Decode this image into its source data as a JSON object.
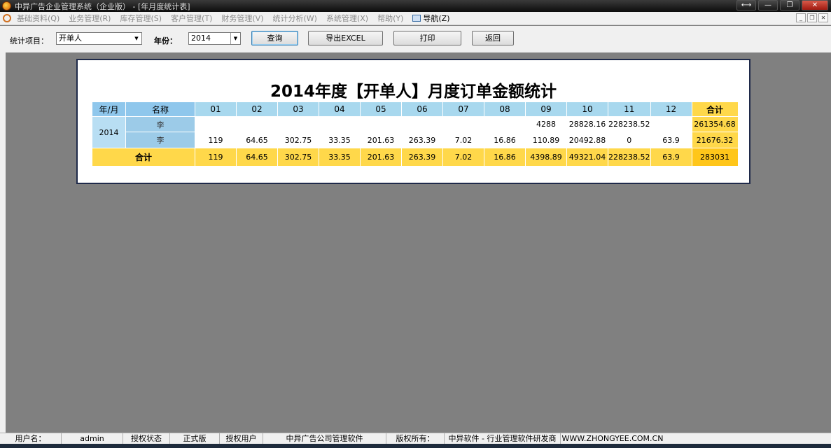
{
  "window": {
    "title": "中异广告企业管理系统（企业版） - [年月度统计表]",
    "controls": {
      "resize": "⟷",
      "minimize": "—",
      "restore": "❐",
      "close": "✕"
    }
  },
  "menu": {
    "items": [
      "基础资料(Q)",
      "业务管理(R)",
      "库存管理(S)",
      "客户管理(T)",
      "财务管理(V)",
      "统计分析(W)",
      "系统管理(X)",
      "帮助(Y)"
    ],
    "nav_label": "导航(Z)"
  },
  "toolbar": {
    "item_label": "统计项目：",
    "item_value": "开单人",
    "year_label": "年份：",
    "year_value": "2014",
    "query_btn": "查询",
    "export_btn": "导出EXCEL",
    "print_btn": "打印",
    "back_btn": "返回"
  },
  "report": {
    "title": "2014年度【开单人】月度订单金额统计",
    "headers": {
      "year_month": "年/月",
      "name": "名称",
      "months": [
        "01",
        "02",
        "03",
        "04",
        "05",
        "06",
        "07",
        "08",
        "09",
        "10",
        "11",
        "12"
      ],
      "total": "合计"
    },
    "year": "2014",
    "rows": [
      {
        "name": "李",
        "values": [
          "",
          "",
          "",
          "",
          "",
          "",
          "",
          "",
          "4288",
          "28828.16",
          "228238.52",
          ""
        ],
        "total": "261354.68"
      },
      {
        "name": "李",
        "values": [
          "119",
          "64.65",
          "302.75",
          "33.35",
          "201.63",
          "263.39",
          "7.02",
          "16.86",
          "110.89",
          "20492.88",
          "0",
          "63.9"
        ],
        "total": "21676.32"
      }
    ],
    "sum_row": {
      "label": "合计",
      "values": [
        "119",
        "64.65",
        "302.75",
        "33.35",
        "201.63",
        "263.39",
        "7.02",
        "16.86",
        "4398.89",
        "49321.04",
        "228238.52",
        "63.9"
      ],
      "total": "283031"
    }
  },
  "status": {
    "user_label": "用户名：",
    "user_value": "admin",
    "auth_status_label": "授权状态",
    "auth_status_value": "正式版",
    "auth_user_label": "授权用户",
    "auth_user_value": "中异广告公司管理软件",
    "copyright_label": "版权所有：",
    "copyright_value": "中异软件 - 行业管理软件研发商",
    "website": "WWW.ZHONGYEE.COM.CN"
  }
}
